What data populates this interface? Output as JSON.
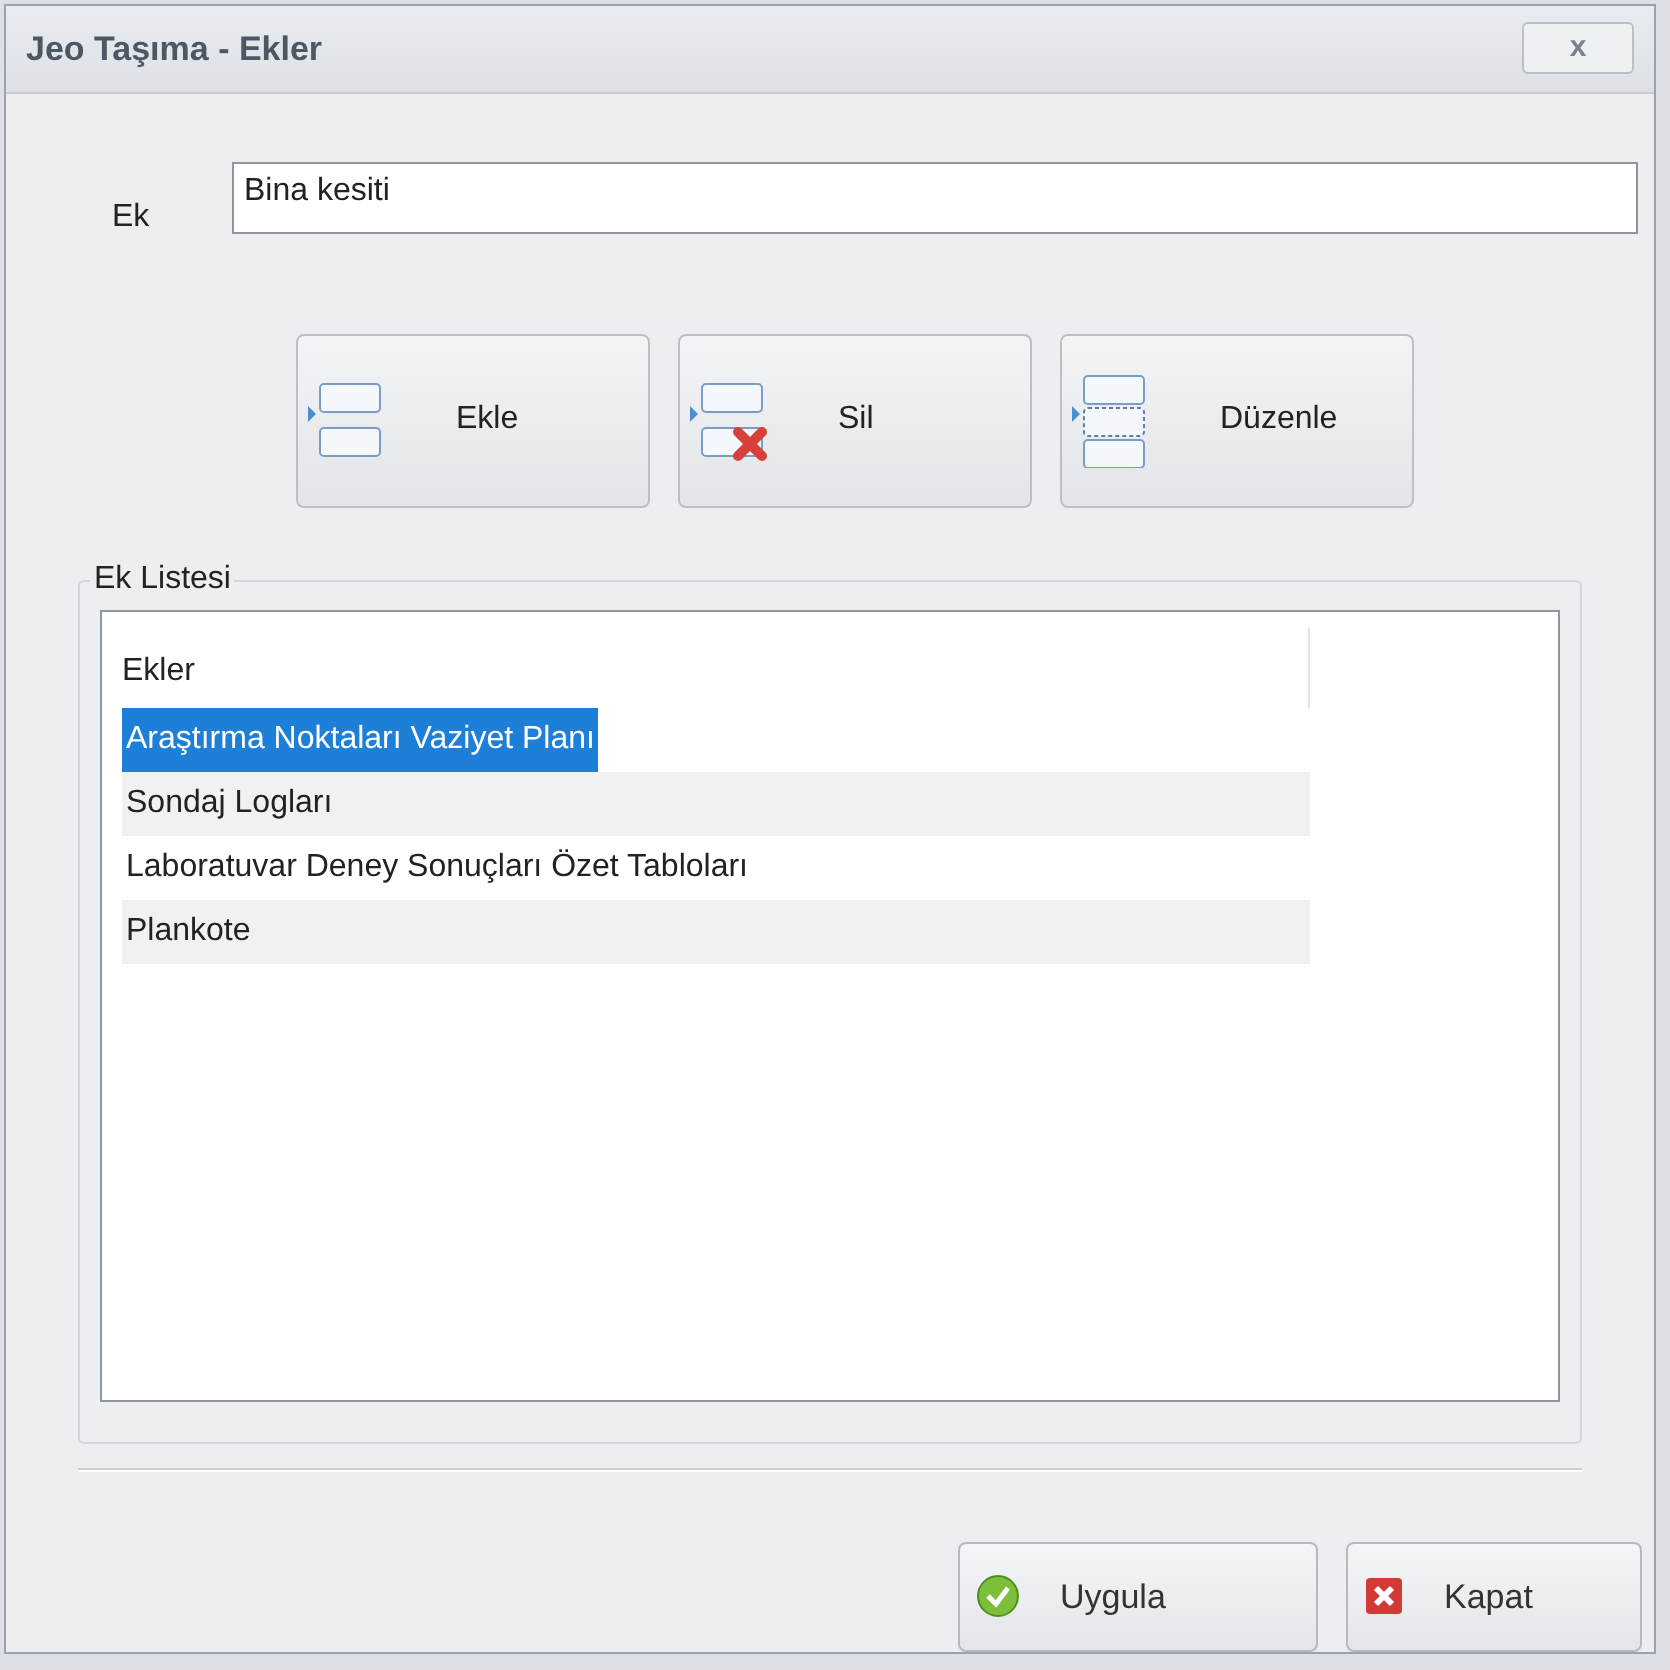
{
  "window": {
    "title": "Jeo Taşıma - Ekler",
    "close": "x"
  },
  "field": {
    "label": "Ek",
    "value": "Bina kesiti"
  },
  "actions": [
    {
      "kind": "add",
      "label": "Ekle"
    },
    {
      "kind": "delete",
      "label": "Sil"
    },
    {
      "kind": "edit",
      "label": "Düzenle"
    }
  ],
  "group": {
    "title": "Ek Listesi",
    "column": "Ekler",
    "rows": [
      {
        "label": "Araştırma Noktaları Vaziyet Planı",
        "selected": true
      },
      {
        "label": "Sondaj Logları",
        "selected": false
      },
      {
        "label": "Laboratuvar Deney Sonuçları Özet Tabloları",
        "selected": false
      },
      {
        "label": "Plankote",
        "selected": false
      }
    ]
  },
  "buttons": [
    {
      "kind": "apply",
      "label": "Uygula"
    },
    {
      "kind": "close",
      "label": "Kapat"
    }
  ]
}
